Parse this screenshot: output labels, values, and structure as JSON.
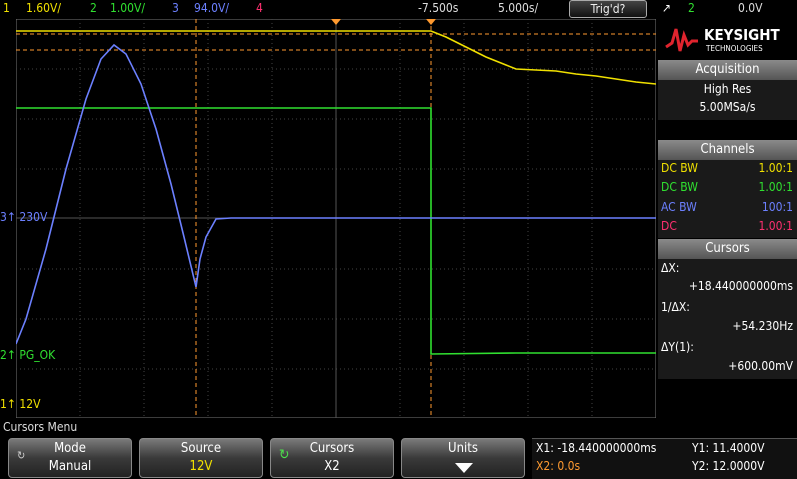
{
  "topbar": {
    "ch1": {
      "num": "1",
      "scale": "1.60V/"
    },
    "ch2": {
      "num": "2",
      "scale": "1.00V/"
    },
    "ch3": {
      "num": "3",
      "scale": "94.0V/"
    },
    "ch4": {
      "num": "4"
    },
    "delay": "-7.500s",
    "timebase": "5.000s/",
    "trig_status": "Trig'd?",
    "trig_source": "2",
    "trig_level": "0.0V"
  },
  "brand": {
    "name": "KEYSIGHT",
    "sub": "TECHNOLOGIES"
  },
  "acquisition": {
    "header": "Acquisition",
    "mode": "High Res",
    "rate": "5.00MSa/s"
  },
  "channels": {
    "header": "Channels",
    "rows": [
      {
        "coupling": "DC BW",
        "probe": "1.00:1",
        "color": "#f0e000"
      },
      {
        "coupling": "DC BW",
        "probe": "1.00:1",
        "color": "#30e030"
      },
      {
        "coupling": "AC BW",
        "probe": "100:1",
        "color": "#6c80ff"
      },
      {
        "coupling": "DC",
        "probe": "1.00:1",
        "color": "#ff3070"
      }
    ]
  },
  "cursors": {
    "header": "Cursors",
    "dx_label": "ΔX:",
    "dx_value": "+18.440000000ms",
    "inv_label": "1/ΔX:",
    "inv_value": "+54.230Hz",
    "dy_label": "ΔY(1):",
    "dy_value": "+600.00mV"
  },
  "markers": {
    "ch3": "230V",
    "ch2": "PG_OK",
    "ch1": "12V"
  },
  "menu": {
    "title": "Cursors Menu",
    "keys": [
      {
        "label": "Mode",
        "value": "Manual"
      },
      {
        "label": "Source",
        "value": "12V"
      },
      {
        "label": "Cursors",
        "value": "X2"
      },
      {
        "label": "Units",
        "value": ""
      }
    ]
  },
  "readout": {
    "x1": "X1: -18.440000000ms",
    "y1": "Y1: 11.4000V",
    "x2": "X2: 0.0s",
    "y2": "Y2: 12.0000V"
  },
  "colors": {
    "ch1": "#f0e000",
    "ch2": "#30e030",
    "ch3": "#6c80ff",
    "ch4": "#ff3070",
    "cursor": "#ff9a30"
  }
}
